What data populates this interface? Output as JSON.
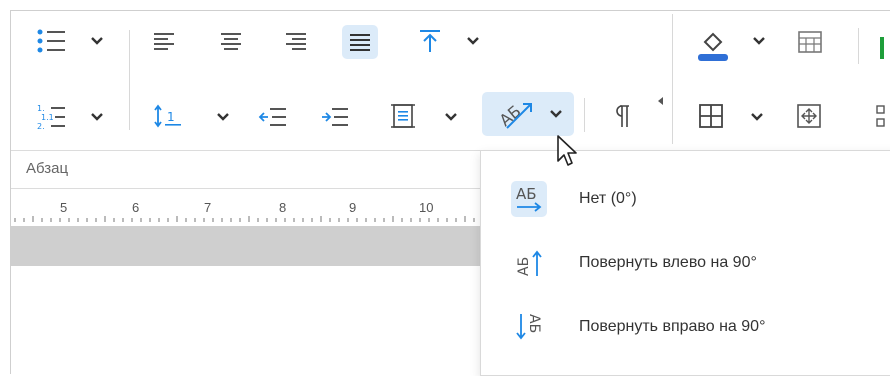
{
  "group": {
    "label": "Абзац"
  },
  "ruler": {
    "numbers": [
      "5",
      "6",
      "7",
      "8",
      "9",
      "10"
    ]
  },
  "menu": {
    "items": [
      {
        "label": "Нет (0°)",
        "icon_text": "АБ"
      },
      {
        "label": "Повернуть влево на 90°",
        "icon_text": "АБ"
      },
      {
        "label": "Повернуть вправо на 90°",
        "icon_text": "АБ"
      }
    ]
  },
  "colors": {
    "accent": "#1e88e5",
    "active_bg": "#dcebf9",
    "fill_bar": "#2f6fd6",
    "green": "#1e9e3a"
  }
}
